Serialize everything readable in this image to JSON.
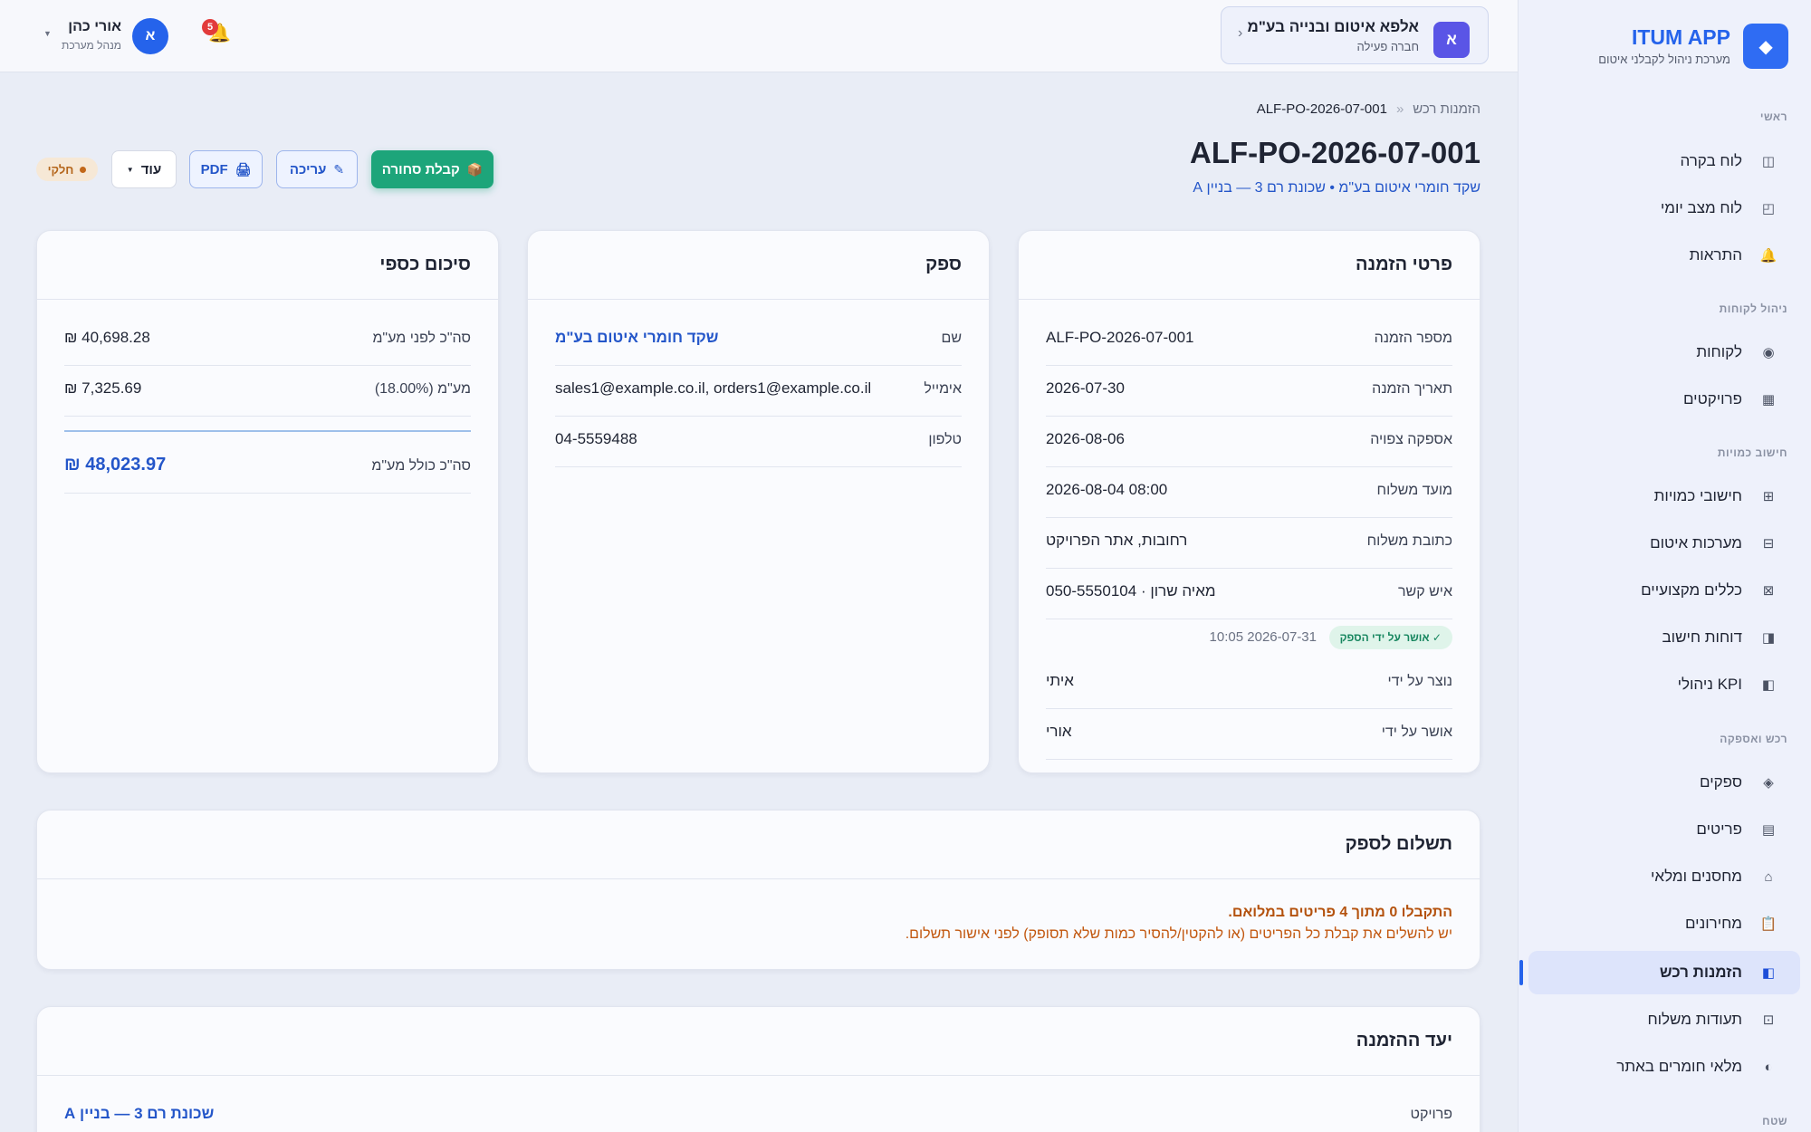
{
  "app": {
    "title": "ITUM APP",
    "subtitle": "מערכת ניהול לקבלני איטום",
    "logo_icon": "◆"
  },
  "topbar": {
    "company": {
      "avatar": "א",
      "name": "אלפא איטום ובנייה בע\"מ",
      "status": "חברה פעילה"
    },
    "notifications_count": "5",
    "user": {
      "avatar": "א",
      "name": "אורי כהן",
      "role": "מנהל מערכת"
    }
  },
  "sidebar": {
    "sections": [
      {
        "title": "ראשי",
        "items": [
          {
            "label": "לוח בקרה",
            "icon": "◫"
          },
          {
            "label": "לוח מצב יומי",
            "icon": "◰"
          },
          {
            "label": "התראות",
            "icon": "🔔"
          }
        ]
      },
      {
        "title": "ניהול לקוחות",
        "items": [
          {
            "label": "לקוחות",
            "icon": "◉"
          },
          {
            "label": "פרויקטים",
            "icon": "▦"
          }
        ]
      },
      {
        "title": "חישוב כמויות",
        "items": [
          {
            "label": "חישובי כמויות",
            "icon": "⊞"
          },
          {
            "label": "מערכות איטום",
            "icon": "⊟"
          },
          {
            "label": "כללים מקצועיים",
            "icon": "⊠"
          },
          {
            "label": "דוחות חישוב",
            "icon": "◨"
          },
          {
            "label": "KPI ניהולי",
            "icon": "◧"
          }
        ]
      },
      {
        "title": "רכש ואספקה",
        "items": [
          {
            "label": "ספקים",
            "icon": "◈"
          },
          {
            "label": "פריטים",
            "icon": "▤"
          },
          {
            "label": "מחסנים ומלאי",
            "icon": "⌂"
          },
          {
            "label": "מחירונים",
            "icon": "📋"
          },
          {
            "label": "הזמנות רכש",
            "icon": "◧",
            "active": true
          },
          {
            "label": "תעודות משלוח",
            "icon": "⊡"
          },
          {
            "label": "מלאי חומרים באתר",
            "icon": "◐"
          }
        ]
      },
      {
        "title": "שטח",
        "items": []
      }
    ]
  },
  "page": {
    "breadcrumb": {
      "parent": "הזמנות רכש",
      "sep": "«",
      "current": "ALF-PO-2026-07-001"
    },
    "title": "ALF-PO-2026-07-001",
    "subtitle": "שקד חומרי איטום בע\"מ • שכונת רם 3 — בניין A",
    "actions": {
      "receive": "קבלת סחורה",
      "edit": "עריכה",
      "pdf": "PDF",
      "more": "עוד"
    },
    "status": "חלקי"
  },
  "order_details": {
    "title": "פרטי הזמנה",
    "rows": [
      {
        "label": "מספר הזמנה",
        "value": "ALF-PO-2026-07-001"
      },
      {
        "label": "תאריך הזמנה",
        "value": "2026-07-30"
      },
      {
        "label": "אספקה צפויה",
        "value": "2026-08-06"
      },
      {
        "label": "מועד משלוח",
        "value": "2026-08-04 08:00"
      },
      {
        "label": "כתובת משלוח",
        "value": "רחובות, אתר הפרויקט"
      },
      {
        "label": "איש קשר",
        "value": "מאיה שרון · 050-5550104"
      }
    ],
    "supplier_approved": {
      "badge": "✓ אושר על ידי הספק",
      "time": "2026-07-31 10:05"
    },
    "created_by": {
      "label": "נוצר על ידי",
      "value": "איתי"
    },
    "approved_by": {
      "label": "אושר על ידי",
      "value": "אורי"
    }
  },
  "supplier": {
    "title": "ספק",
    "rows": [
      {
        "label": "שם",
        "value": "שקד חומרי איטום בע\"מ"
      },
      {
        "label": "אימייל",
        "value": "sales1@example.co.il, orders1@example.co.il"
      },
      {
        "label": "טלפון",
        "value": "04-5559488"
      }
    ]
  },
  "financial": {
    "title": "סיכום כספי",
    "subtotal": {
      "label": "סה\"כ לפני מע\"מ",
      "value": "₪ 40,698.28"
    },
    "vat": {
      "label": "מע\"מ (18.00%)",
      "value": "₪ 7,325.69"
    },
    "total": {
      "label": "סה\"כ כולל מע\"מ",
      "value": "₪ 48,023.97"
    }
  },
  "payment": {
    "title": "תשלום לספק",
    "warning_title": "התקבלו 0 מתוך 4 פריטים במלואם.",
    "warning_text": "יש להשלים את קבלת כל הפריטים (או להקטין/להסיר כמות שלא תסופק) לפני אישור תשלום."
  },
  "destination": {
    "title": "יעד ההזמנה",
    "project_label": "פרויקט",
    "project_value": "שכונת רם 3 — בניין A"
  },
  "colors": {
    "accent": "#2563eb",
    "success": "#1da57a",
    "warning": "#b4520e",
    "danger": "#e23b3b"
  }
}
